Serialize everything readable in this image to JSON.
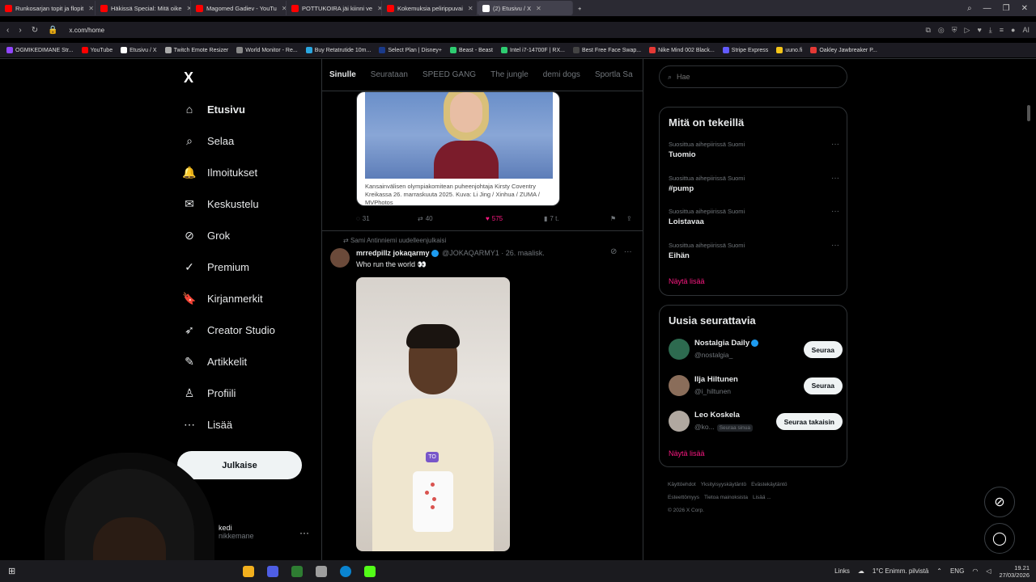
{
  "browser": {
    "tabs": [
      {
        "label": "Runkosarjan topit ja flopit",
        "color": "#ff0000",
        "active": false
      },
      {
        "label": "Häkissä Special: Mitä oike",
        "color": "#ff0000",
        "active": false
      },
      {
        "label": "Magomed Gadiev - YouTu",
        "color": "#ff0000",
        "active": false
      },
      {
        "label": "POTTUKOIRA jäi kiinni ve",
        "color": "#ff0000",
        "active": false
      },
      {
        "label": "Kokemuksia pelirippuvai",
        "color": "#ff0000",
        "active": false
      },
      {
        "label": "(2) Etusivu / X",
        "color": "#ffffff",
        "active": true
      }
    ],
    "new_tab": "+",
    "url": "x.com/home",
    "bookmarks": [
      {
        "label": "OGMIKEDIMANE Str...",
        "color": "#9146ff"
      },
      {
        "label": "YouTube",
        "color": "#ff0000"
      },
      {
        "label": "Etusivu / X",
        "color": "#ffffff"
      },
      {
        "label": "Twitch Emote Resizer",
        "color": "#aaaaaa"
      },
      {
        "label": "World Monitor - Re...",
        "color": "#888888"
      },
      {
        "label": "Buy Retatrutide 10m...",
        "color": "#2aa7e0"
      },
      {
        "label": "Select Plan | Disney+",
        "color": "#1a3a8a"
      },
      {
        "label": "Beast - Beast",
        "color": "#2ecc71"
      },
      {
        "label": "Intel i7-14700F | RX...",
        "color": "#2ecc71"
      },
      {
        "label": "Best Free Face Swap...",
        "color": "#444444"
      },
      {
        "label": "Nike Mind 002 Black...",
        "color": "#e53935"
      },
      {
        "label": "Stripe Express",
        "color": "#635bff"
      },
      {
        "label": "uuno.fi",
        "color": "#f5c518"
      },
      {
        "label": "Oakley Jawbreaker P...",
        "color": "#e53935"
      }
    ]
  },
  "nav": {
    "logo": "X",
    "items": [
      {
        "label": "Etusivu",
        "icon": "home-icon",
        "glyph": "⌂",
        "bold": true
      },
      {
        "label": "Selaa",
        "icon": "search-icon",
        "glyph": "⌕"
      },
      {
        "label": "Ilmoitukset",
        "icon": "bell-icon",
        "glyph": "🔔"
      },
      {
        "label": "Keskustelu",
        "icon": "mail-icon",
        "glyph": "✉"
      },
      {
        "label": "Grok",
        "icon": "grok-icon",
        "glyph": "⊘"
      },
      {
        "label": "Premium",
        "icon": "verified-icon",
        "glyph": "✓"
      },
      {
        "label": "Kirjanmerkit",
        "icon": "bookmark-icon",
        "glyph": "🔖"
      },
      {
        "label": "Creator Studio",
        "icon": "rocket-icon",
        "glyph": "➶"
      },
      {
        "label": "Artikkelit",
        "icon": "article-icon",
        "glyph": "✎"
      },
      {
        "label": "Profiili",
        "icon": "profile-icon",
        "glyph": "♙"
      },
      {
        "label": "Lisää",
        "icon": "more-circle-icon",
        "glyph": "⋯"
      }
    ],
    "post_button": "Julkaise",
    "account_name": "kedi",
    "account_handle": "nikkemane"
  },
  "feed": {
    "tabs": [
      "Sinulle",
      "Seurataan",
      "SPEED GANG",
      "The jungle",
      "demi dogs",
      "Sportla Sa"
    ],
    "post1": {
      "caption": "Kansainvälisen olympiakomitean puheenjohtaja Kirsty Coventry Kreikassa 26. marraskuuta 2025. Kuva: Li Jing / Xinhua / ZUMA / MVPhotos",
      "replies": "31",
      "reposts": "40",
      "likes": "575",
      "views": "7 t."
    },
    "post2": {
      "repost_label": "Sami Antinniemi uudelleenjulkaisi",
      "name": "mrredpillz jokaqarmy",
      "handle": "@JOKAQARMY1",
      "date": "· 26. maalisk.",
      "text": "Who run the world 👀",
      "video_badge": "TO"
    }
  },
  "right": {
    "search_placeholder": "Hae",
    "trends_title": "Mitä on tekeillä",
    "trends": [
      {
        "context": "Suosittua aihepiirissä Suomi",
        "title": "Tuomio"
      },
      {
        "context": "Suosittua aihepiirissä Suomi",
        "title": "#pump"
      },
      {
        "context": "Suosittua aihepiirissä Suomi",
        "title": "Loistavaa"
      },
      {
        "context": "Suosittua aihepiirissä Suomi",
        "title": "Eihän"
      }
    ],
    "trends_more": "Näytä lisää",
    "follow_title": "Uusia seurattavia",
    "follows": [
      {
        "name": "Nostalgia Daily",
        "handle": "@nostalgia_",
        "button": "Seuraa",
        "verified": true,
        "color": "#2d6a4f"
      },
      {
        "name": "Ilja Hiltunen",
        "handle": "@i_hiltunen",
        "button": "Seuraa",
        "verified": false,
        "color": "#8a6d5a"
      },
      {
        "name": "Leo Koskela",
        "handle": "@ko...",
        "follows_you": "Seuraa sinua",
        "button": "Seuraa takaisin",
        "verified": false,
        "color": "#b0a8a0"
      }
    ],
    "follow_more": "Näytä lisää",
    "footer": [
      "Käyttöehdot",
      "Yksityisyyskäytäntö",
      "Evästekäytäntö",
      "Esteettömyys",
      "Tietoa mainoksista",
      "Lisää ...",
      "© 2026 X Corp."
    ]
  },
  "taskbar": {
    "links": "Links",
    "weather": "1°C  Enimm. pilvistä",
    "lang": "ENG",
    "time": "19.21",
    "date": "27/03/2026"
  }
}
